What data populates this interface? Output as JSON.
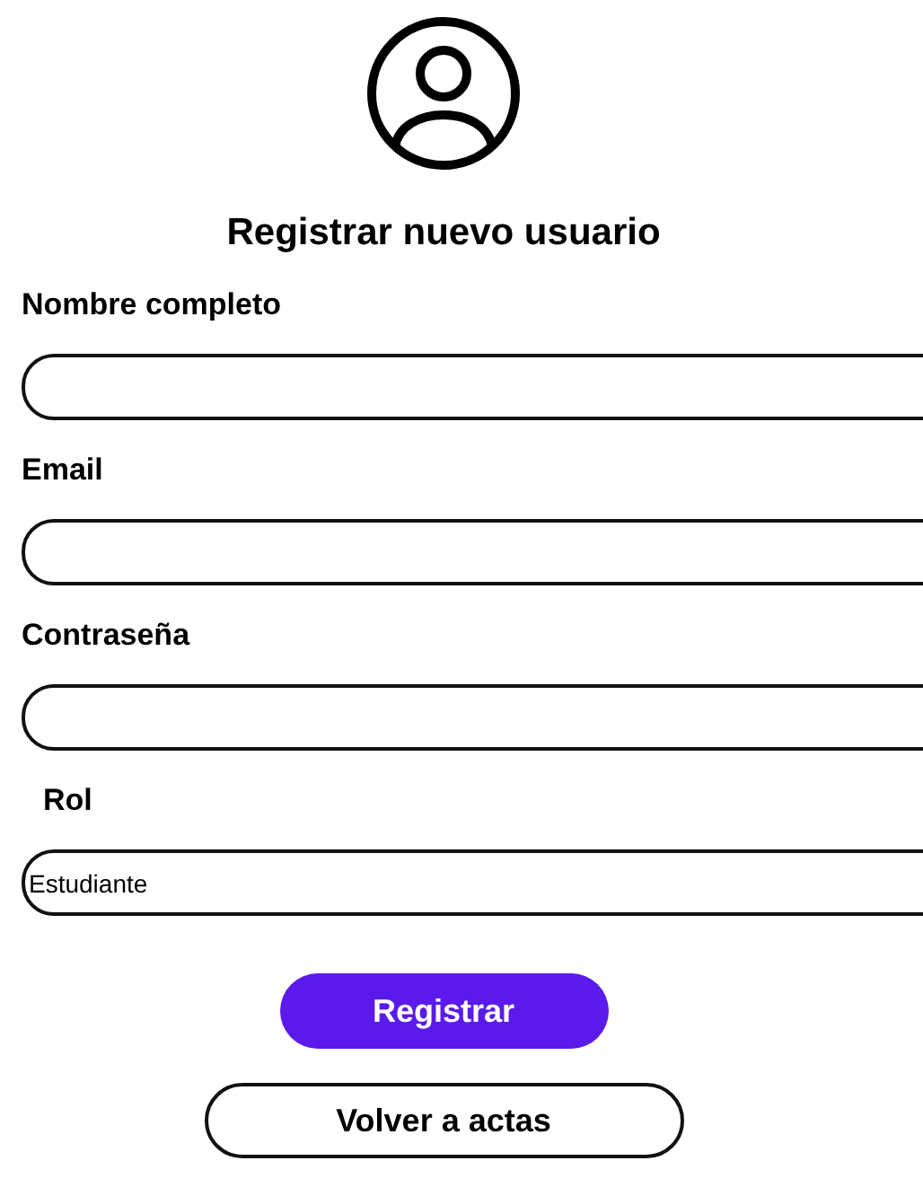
{
  "title": "Registrar nuevo usuario",
  "fields": [
    {
      "label": "Nombre completo",
      "kind": "text"
    },
    {
      "label": "Email",
      "kind": "text"
    },
    {
      "label": "Contraseña",
      "kind": "text"
    },
    {
      "label": "Rol",
      "kind": "select",
      "value": "Estudiante"
    }
  ],
  "buttons": [
    {
      "label": "Registrar",
      "kind": "primary"
    },
    {
      "label": "Volver a actas",
      "kind": "outline"
    }
  ]
}
